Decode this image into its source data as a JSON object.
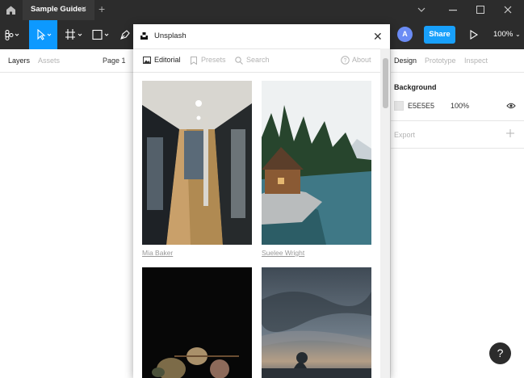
{
  "tabbar": {
    "file_tab": "Sample Guides",
    "close": "✕",
    "new_tab": "+"
  },
  "toolbar": {
    "share": "Share",
    "avatar": "A",
    "zoom": "100%"
  },
  "left_panel": {
    "tabs": [
      "Layers",
      "Assets"
    ],
    "page": "Page 1"
  },
  "right_panel": {
    "tabs": [
      "Design",
      "Prototype",
      "Inspect"
    ],
    "background_heading": "Background",
    "background_hex": "E5E5E5",
    "background_opacity": "100%",
    "export_heading": "Export",
    "canvas_color": "#e5e5e5"
  },
  "modal": {
    "title": "Unsplash",
    "close": "✕",
    "tabs": [
      "Editorial",
      "Presets",
      "Search"
    ],
    "about": "About",
    "photos": [
      {
        "credit": "Mia Baker",
        "subject": "corridor"
      },
      {
        "credit": "Suelee Wright",
        "subject": "cabin-lake"
      },
      {
        "credit": "",
        "subject": "dried-flowers"
      },
      {
        "credit": "",
        "subject": "stormy-sky"
      }
    ]
  },
  "help": {
    "label": "?"
  },
  "colors": {
    "accent": "#0d99ff",
    "share": "#18a0fb",
    "dark": "#2c2c2c"
  }
}
